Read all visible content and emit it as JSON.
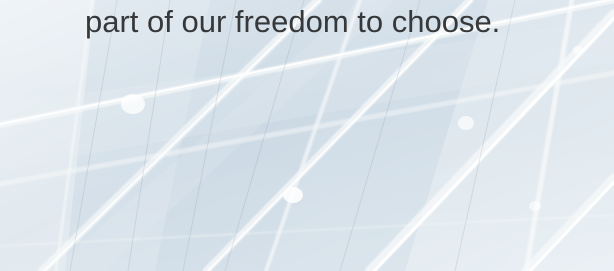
{
  "hero": {
    "text": "part of our freedom to choose.",
    "background": {
      "base": "#dfe8ef",
      "frame": "#f7f9fa",
      "glass": "#c9d8e4",
      "text": "#36383a"
    }
  }
}
